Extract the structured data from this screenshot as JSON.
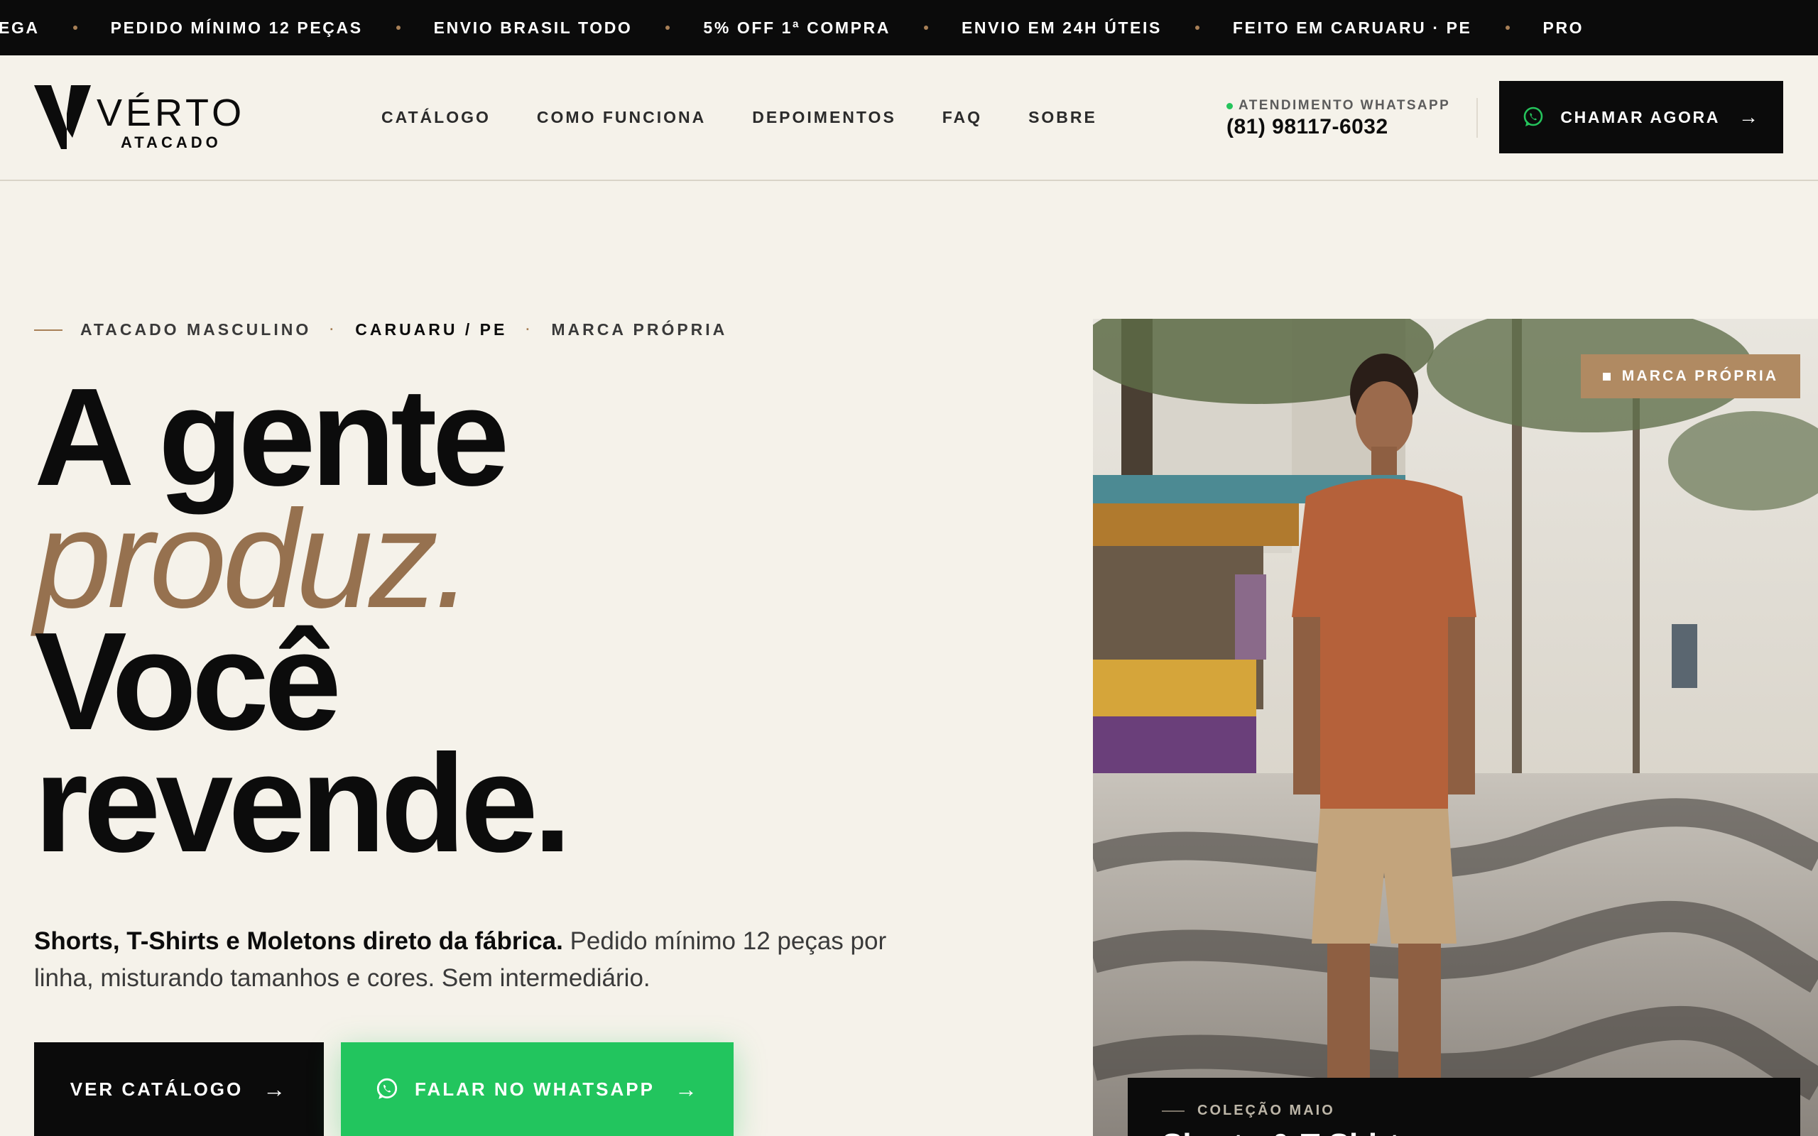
{
  "ticker": {
    "items": [
      "EGA",
      "PEDIDO MÍNIMO 12 PEÇAS",
      "ENVIO BRASIL TODO",
      "5% OFF 1ª COMPRA",
      "ENVIO EM 24H ÚTEIS",
      "FEITO EM CARUARU · PE",
      "PRO"
    ]
  },
  "brand": {
    "name": "VÉRTO",
    "sub": "ATACADO"
  },
  "nav": {
    "items": [
      "CATÁLOGO",
      "COMO FUNCIONA",
      "DEPOIMENTOS",
      "FAQ",
      "SOBRE"
    ]
  },
  "contact": {
    "label": "ATENDIMENTO WHATSAPP",
    "phone": "(81) 98117-6032",
    "cta": "CHAMAR AGORA"
  },
  "hero": {
    "eyebrow": [
      "ATACADO MASCULINO",
      "CARUARU / PE",
      "MARCA PRÓPRIA"
    ],
    "headline": [
      "A gente",
      "produz.",
      "Você",
      "revende."
    ],
    "lede_bold": "Shorts, T-Shirts e Moletons direto da fábrica.",
    "lede_rest": " Pedido mínimo 12 peças por linha, misturando tamanhos e cores. Sem intermediário.",
    "btn_catalog": "VER CATÁLOGO",
    "btn_whatsapp": "FALAR NO WHATSAPP",
    "badge": "MARCA PRÓPRIA",
    "collection_label": "COLEÇÃO MAIO",
    "collection_title": "Shorts & T-Shirts"
  },
  "colors": {
    "background": "#f5f2ea",
    "dark": "#0b0b0b",
    "accent": "#96714f",
    "whatsapp": "#22c55e"
  }
}
